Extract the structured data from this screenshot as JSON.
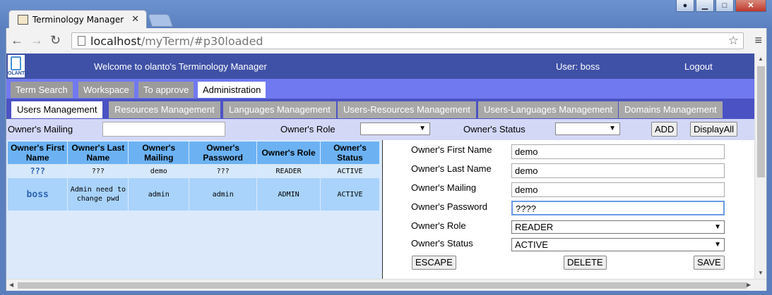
{
  "browser": {
    "tab_title": "Terminology Manager",
    "url_host": "localhost",
    "url_path": "/myTerm/#p30loaded"
  },
  "header": {
    "logo_text": "OLANTO",
    "welcome": "Welcome to olanto's Terminology Manager",
    "user": "User: boss",
    "logout": "Logout"
  },
  "main_tabs": [
    "Term Search",
    "Workspace",
    "To approve",
    "Administration"
  ],
  "sub_tabs": [
    "Users Management",
    "Resources Management",
    "Languages Management",
    "Users-Resources Management",
    "Users-Languages Management",
    "Domains Management"
  ],
  "filters": {
    "mailing_label": "Owner's Mailing",
    "mailing_value": "",
    "role_label": "Owner's Role",
    "role_value": "",
    "status_label": "Owner's Status",
    "status_value": "",
    "add": "ADD",
    "display_all": "DisplayAll"
  },
  "table": {
    "columns": [
      "Owner's First Name",
      "Owner's Last Name",
      "Owner's Mailing",
      "Owner's Password",
      "Owner's Role",
      "Owner's Status"
    ],
    "rows": [
      [
        "???",
        "???",
        "demo",
        "???",
        "READER",
        "ACTIVE"
      ],
      [
        "boss",
        "Admin need to change pwd",
        "admin",
        "admin",
        "ADMIN",
        "ACTIVE"
      ]
    ]
  },
  "form": {
    "first_name_label": "Owner's First Name",
    "first_name": "demo",
    "last_name_label": "Owner's Last Name",
    "last_name": "demo",
    "mailing_label": "Owner's Mailing",
    "mailing": "demo",
    "password_label": "Owner's Password",
    "password": "????",
    "role_label": "Owner's Role",
    "role": "READER",
    "status_label": "Owner's Status",
    "status": "ACTIVE",
    "escape": "ESCAPE",
    "delete": "DELETE",
    "save": "SAVE"
  }
}
